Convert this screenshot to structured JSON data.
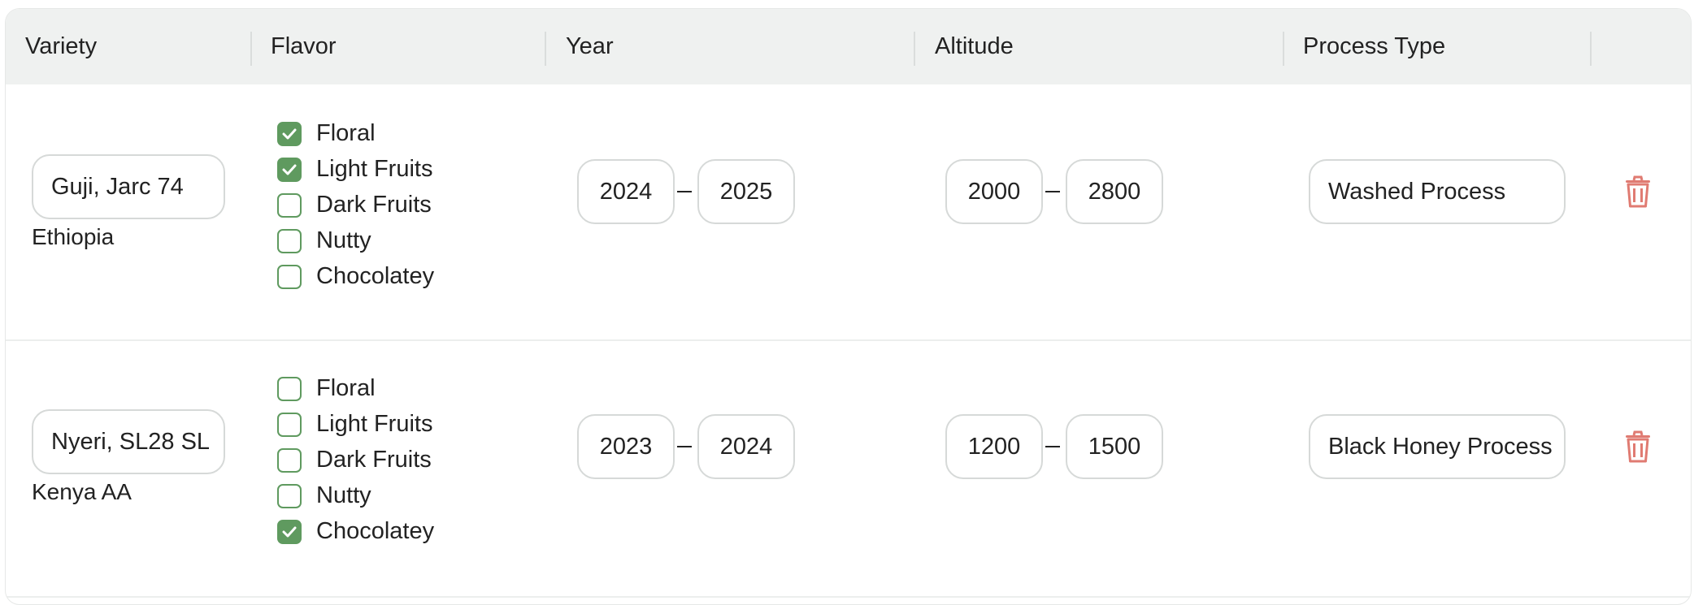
{
  "headers": {
    "variety": "Variety",
    "flavor": "Flavor",
    "year": "Year",
    "altitude": "Altitude",
    "process_type": "Process Type"
  },
  "rows": [
    {
      "variety_input": "Guji, Jarc 74",
      "origin": "Ethiopia",
      "flavors": [
        {
          "label": "Floral",
          "checked": true
        },
        {
          "label": "Light Fruits",
          "checked": true
        },
        {
          "label": "Dark Fruits",
          "checked": false
        },
        {
          "label": "Nutty",
          "checked": false
        },
        {
          "label": "Chocolatey",
          "checked": false
        }
      ],
      "year_from": "2024",
      "year_to": "2025",
      "altitude_from": "2000",
      "altitude_to": "2800",
      "process": "Washed Process"
    },
    {
      "variety_input": "Nyeri, SL28 SL",
      "origin": "Kenya AA",
      "flavors": [
        {
          "label": "Floral",
          "checked": false
        },
        {
          "label": "Light Fruits",
          "checked": false
        },
        {
          "label": "Dark Fruits",
          "checked": false
        },
        {
          "label": "Nutty",
          "checked": false
        },
        {
          "label": "Chocolatey",
          "checked": true
        }
      ],
      "year_from": "2023",
      "year_to": "2024",
      "altitude_from": "1200",
      "altitude_to": "1500",
      "process": "Black Honey Process"
    }
  ],
  "colors": {
    "checkbox_green": "#5f9a5f",
    "trash_red": "#e07b72",
    "header_bg": "#eff1f0"
  },
  "icons": {
    "delete": "trash-icon",
    "check": "checkmark-icon"
  }
}
